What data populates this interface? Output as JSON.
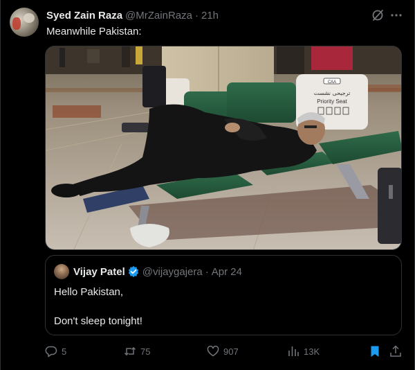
{
  "tweet": {
    "author_name": "Syed Zain Raza",
    "handle": "@MrZainRaza",
    "separator": "·",
    "time": "21h",
    "text": "Meanwhile Pakistan:"
  },
  "media": {
    "sign_org": "CAA",
    "sign_urdu": "ترجیحی نشست",
    "sign_label": "Priority Seat"
  },
  "quote": {
    "author_name": "Vijay Patel",
    "handle": "@vijaygajera",
    "separator": "·",
    "date": "Apr 24",
    "line1": "Hello Pakistan,",
    "line2": "Don't sleep tonight!"
  },
  "actions": {
    "replies": "5",
    "reposts": "75",
    "likes": "907",
    "views": "13K"
  },
  "colors": {
    "background": "#000000",
    "text": "#e7e9ea",
    "muted": "#71767b",
    "accent": "#1d9bf0",
    "border": "#2f3336"
  },
  "icons": [
    "grok-icon",
    "more-icon",
    "verified-badge-icon",
    "reply-icon",
    "repost-icon",
    "like-icon",
    "views-icon",
    "bookmark-icon",
    "share-icon"
  ]
}
